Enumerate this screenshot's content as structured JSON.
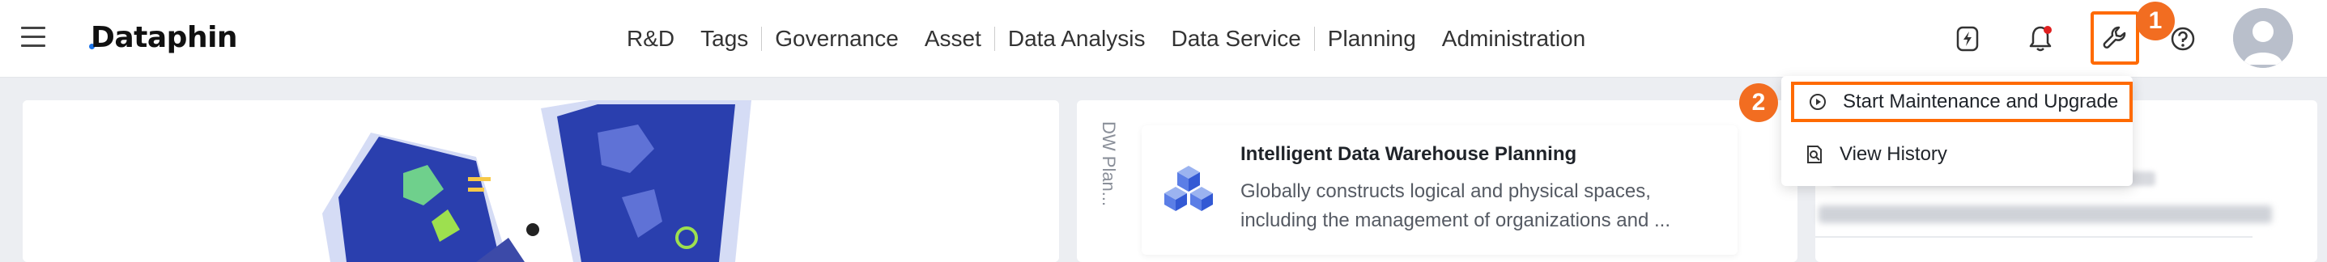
{
  "header": {
    "logo_text": "Dataphin",
    "logo_accent_color": "#1a73e8",
    "nav_items": [
      "R&D",
      "Tags",
      "Governance",
      "Asset",
      "Data Analysis",
      "Data Service",
      "Planning",
      "Administration"
    ],
    "icons": [
      "menu-icon",
      "lightning-icon",
      "bell-icon",
      "wrench-icon",
      "help-icon",
      "avatar-icon"
    ],
    "notification_dot_color": "#e02020"
  },
  "annotations": {
    "badge_1": "1",
    "badge_2": "2",
    "highlight_color": "#ff6a00",
    "badge_color": "#f26d21"
  },
  "dropdown": {
    "items": [
      {
        "label": "Start Maintenance and Upgrade",
        "icon": "play-circle-icon"
      },
      {
        "label": "View History",
        "icon": "document-search-icon"
      }
    ]
  },
  "planning_panel": {
    "side_tab": "DW Plan...",
    "card_title": "Intelligent Data Warehouse Planning",
    "card_description": "Globally constructs logical and physical spaces, including the management of organizations and ..."
  }
}
